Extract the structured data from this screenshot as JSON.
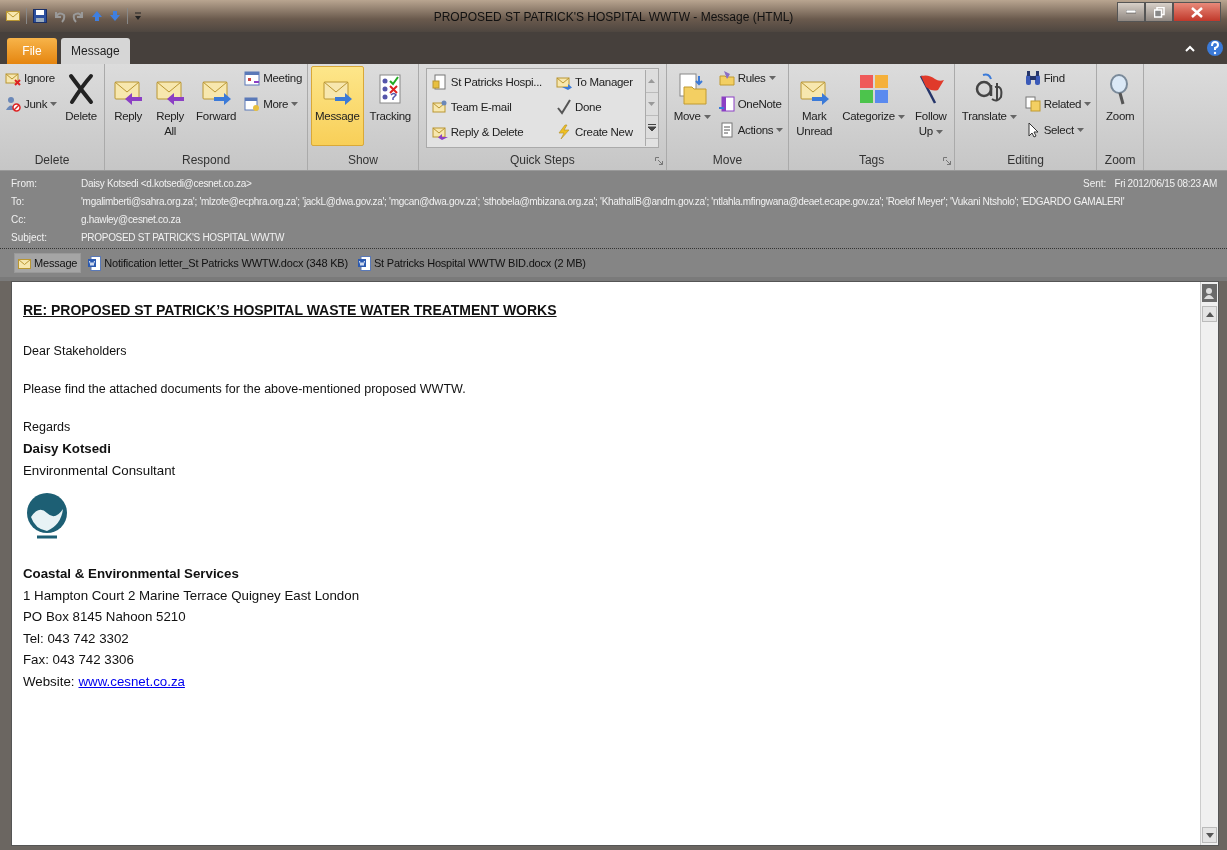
{
  "window": {
    "title": "PROPOSED ST PATRICK'S HOSPITAL WWTW  -  Message (HTML)"
  },
  "tabs": [
    {
      "label": "File",
      "kind": "file",
      "selected": false
    },
    {
      "label": "Message",
      "kind": "tab",
      "selected": true
    }
  ],
  "ribbon": {
    "groups": [
      {
        "label": "Delete",
        "kind": "buttons",
        "launcher": false,
        "columns": [
          {
            "items": [
              {
                "label": "Ignore",
                "kind": "small"
              },
              {
                "label": "Junk",
                "kind": "small",
                "dropdown": true
              }
            ]
          },
          {
            "items": [
              {
                "label": "Delete",
                "kind": "large"
              }
            ]
          }
        ]
      },
      {
        "label": "Respond",
        "kind": "buttons",
        "launcher": false,
        "columns": [
          {
            "items": [
              {
                "label": "Reply",
                "kind": "large"
              }
            ]
          },
          {
            "items": [
              {
                "label": "Reply\nAll",
                "kind": "large"
              }
            ]
          },
          {
            "items": [
              {
                "label": "Forward",
                "kind": "large"
              }
            ]
          },
          {
            "items": [
              {
                "label": "Meeting",
                "kind": "small"
              },
              {
                "label": "More",
                "kind": "small",
                "dropdown": true
              }
            ]
          }
        ]
      },
      {
        "label": "Show",
        "kind": "buttons",
        "launcher": false,
        "columns": [
          {
            "items": [
              {
                "label": "Message",
                "kind": "large",
                "on": true
              }
            ]
          },
          {
            "items": [
              {
                "label": "Tracking",
                "kind": "large",
                "on": false
              }
            ]
          }
        ]
      },
      {
        "label": "Quick Steps",
        "kind": "gallery",
        "launcher": true,
        "columns": [
          {
            "items": [
              {
                "label": "St Patricks Hospi...",
                "kind": "small"
              },
              {
                "label": "Team E-mail",
                "kind": "small"
              },
              {
                "label": "Reply & Delete",
                "kind": "small"
              }
            ]
          },
          {
            "items": [
              {
                "label": "To Manager",
                "kind": "small"
              },
              {
                "label": "Done",
                "kind": "small"
              },
              {
                "label": "Create New",
                "kind": "small"
              }
            ]
          }
        ]
      },
      {
        "label": "Move",
        "kind": "buttons",
        "launcher": false,
        "columns": [
          {
            "items": [
              {
                "label": "Move",
                "kind": "large",
                "dropdown": true
              }
            ]
          },
          {
            "items": [
              {
                "label": "Rules",
                "kind": "small",
                "dropdown": true
              },
              {
                "label": "OneNote",
                "kind": "small"
              },
              {
                "label": "Actions",
                "kind": "small",
                "dropdown": true
              }
            ]
          }
        ]
      },
      {
        "label": "Tags",
        "kind": "buttons",
        "launcher": true,
        "columns": [
          {
            "items": [
              {
                "label": "Mark\nUnread",
                "kind": "large"
              }
            ]
          },
          {
            "items": [
              {
                "label": "Categorize",
                "kind": "large",
                "dropdown": true
              }
            ]
          },
          {
            "items": [
              {
                "label": "Follow\nUp",
                "kind": "large",
                "dropdown": true
              }
            ]
          }
        ]
      },
      {
        "label": "Editing",
        "kind": "buttons",
        "launcher": false,
        "columns": [
          {
            "items": [
              {
                "label": "Translate",
                "kind": "large",
                "dropdown": true
              }
            ]
          },
          {
            "items": [
              {
                "label": "Find",
                "kind": "small"
              },
              {
                "label": "Related",
                "kind": "small",
                "dropdown": true
              },
              {
                "label": "Select",
                "kind": "small",
                "dropdown": true
              }
            ]
          }
        ]
      },
      {
        "label": "Zoom",
        "kind": "buttons",
        "launcher": false,
        "columns": [
          {
            "items": [
              {
                "label": "Zoom",
                "kind": "large"
              }
            ]
          }
        ]
      }
    ]
  },
  "header": {
    "fields": [
      {
        "label": "From:",
        "value": "Daisy Kotsedi <d.kotsedi@cesnet.co.za>"
      },
      {
        "label": "To:",
        "value": "'mgalimberti@sahra.org.za'; 'mlzote@ecphra.org.za'; 'jackL@dwa.gov.za'; 'mgcan@dwa.gov.za'; 'sthobela@mbizana.org.za'; 'KhathaliB@andm.gov.za'; 'ntlahla.mfingwana@deaet.ecape.gov.za'; 'Roelof Meyer'; 'Vukani Ntsholo'; 'EDGARDO GAMALERI'"
      },
      {
        "label": "Cc:",
        "value": "g.hawley@cesnet.co.za"
      },
      {
        "label": "Subject:",
        "value": "PROPOSED ST PATRICK'S HOSPITAL WWTW"
      }
    ],
    "sent": {
      "label": "Sent:",
      "value": "Fri 2012/06/15 08:23 AM"
    }
  },
  "attachments": [
    {
      "label": "Message",
      "kind": "message",
      "selected": true
    },
    {
      "label": "Notification letter_St Patricks WWTW.docx (348 KB)",
      "kind": "doc",
      "selected": false
    },
    {
      "label": "St Patricks Hospital WWTW BID.docx (2 MB)",
      "kind": "doc",
      "selected": false
    }
  ],
  "body": {
    "heading": "RE: PROPOSED ST PATRICK’S HOSPITAL WASTE WATER TREATMENT WORKS",
    "paragraphs": [
      "Dear Stakeholders",
      "Please find the attached documents for the above-mentioned proposed WWTW."
    ],
    "closing": "Regards",
    "signature": {
      "name": "Daisy Kotsedi",
      "role": "Environmental Consultant",
      "company": "Coastal & Environmental Services",
      "lines": [
        "1 Hampton Court 2 Marine Terrace Quigney East London",
        "PO Box 8145 Nahoon 5210",
        "Tel: 043 742 3302",
        "Fax: 043 742 3306"
      ],
      "website": {
        "label": "Website:",
        "link": "www.cesnet.co.za"
      }
    }
  }
}
